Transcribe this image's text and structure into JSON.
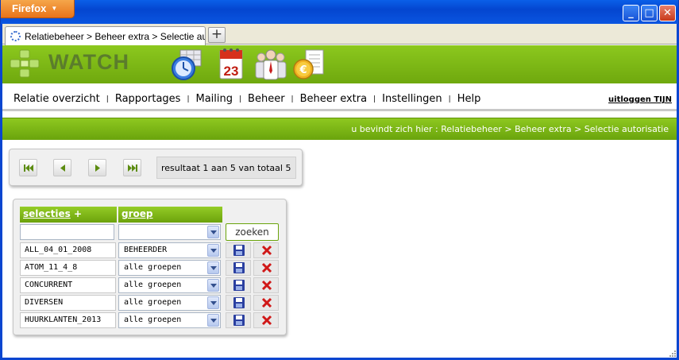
{
  "browser": {
    "menu_button": "Firefox",
    "tab_title": "Relatiebeheer > Beheer extra > Selectie aut...",
    "new_tab": "+",
    "window_buttons": {
      "minimize": "_",
      "maximize": "□",
      "close": "✕"
    }
  },
  "app": {
    "logo_text": "WATCH",
    "header_icons": [
      "clock-icon",
      "calendar-icon",
      "people-icon",
      "euro-invoice-icon"
    ],
    "calendar_day": "23",
    "accent_color": "#7cb818"
  },
  "nav": {
    "items": [
      "Relatie overzicht",
      "Rapportages",
      "Mailing",
      "Beheer",
      "Beheer extra",
      "Instellingen",
      "Help"
    ],
    "separator": "|",
    "logout": "uitloggen TIJN"
  },
  "breadcrumb": "u bevindt zich hier : Relatiebeheer > Beheer extra > Selectie autorisatie",
  "pager": {
    "buttons": [
      "first-page",
      "previous-page",
      "next-page",
      "last-page"
    ],
    "status": "resultaat 1 aan 5 van totaal 5"
  },
  "table": {
    "headers": {
      "selecties": "selecties",
      "add": "+",
      "groep": "groep"
    },
    "filter": {
      "selectie_value": "",
      "groep_value": ""
    },
    "search_button": "zoeken",
    "rows": [
      {
        "selectie": "ALL_04_01_2008",
        "groep": "BEHEERDER"
      },
      {
        "selectie": "ATOM_11_4_8",
        "groep": "alle groepen"
      },
      {
        "selectie": "CONCURRENT",
        "groep": "alle groepen"
      },
      {
        "selectie": "DIVERSEN",
        "groep": "alle groepen"
      },
      {
        "selectie": "HUURKLANTEN_2013",
        "groep": "alle groepen"
      }
    ]
  }
}
